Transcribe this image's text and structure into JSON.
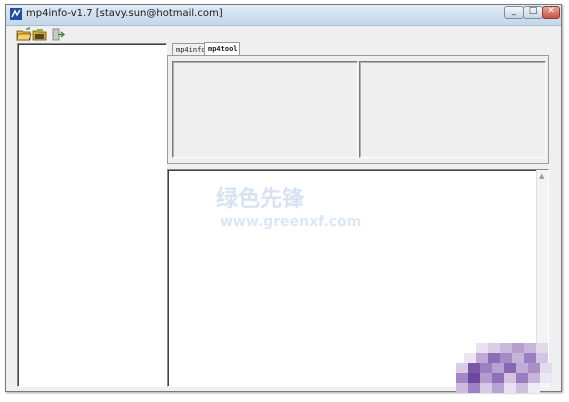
{
  "window": {
    "title": "mp4info-v1.7 [stavy.sun@hotmail.com]"
  },
  "toolbar": {
    "buttons": [
      {
        "name": "open-folder-icon"
      },
      {
        "name": "save-icon"
      },
      {
        "name": "exit-icon"
      }
    ]
  },
  "tabs": [
    {
      "label": "mp4info",
      "active": false
    },
    {
      "label": "mp4tool",
      "active": true
    }
  ],
  "watermark": {
    "text": "绿色先锋",
    "subtext": "www.greenxf.com",
    "color": "#d7e3f2"
  },
  "colors": {
    "window_bg": "#efefef",
    "title_gradient_top": "#dfeaf5",
    "close_button": "#c8523f"
  }
}
